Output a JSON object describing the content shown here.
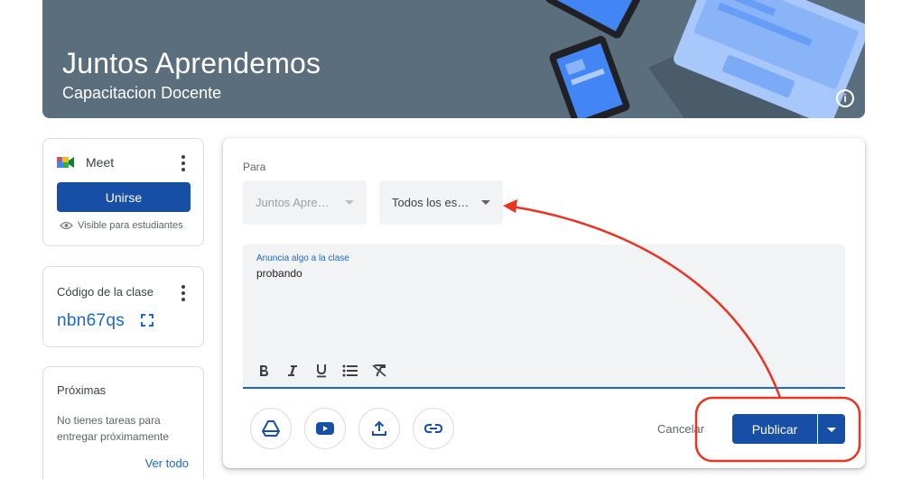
{
  "banner": {
    "title": "Juntos Aprendemos",
    "subtitle": "Capacitacion Docente",
    "info_icon": "info-icon"
  },
  "meet": {
    "label": "Meet",
    "join_label": "Unirse",
    "visible_text": "Visible para estudiantes"
  },
  "class_code": {
    "label": "Código de la clase",
    "value": "nbn67qs"
  },
  "upcoming": {
    "title": "Próximas",
    "text": "No tienes tareas para entregar próximamente",
    "see_all": "Ver todo"
  },
  "composer": {
    "for_label": "Para",
    "class_select": "Juntos Apre…",
    "students_select": "Todos los es…",
    "editor_label": "Anuncia algo a la clase",
    "editor_text": "probando",
    "format_tools": [
      "bold-icon",
      "italic-icon",
      "underline-icon",
      "bulleted-list-icon",
      "clear-format-icon"
    ],
    "attach_tools": [
      "drive-icon",
      "youtube-icon",
      "upload-icon",
      "link-icon"
    ],
    "cancel_label": "Cancelar",
    "publish_label": "Publicar"
  },
  "colors": {
    "primary": "#174ea6",
    "link": "#1967d2",
    "annotation": "#ea3323"
  }
}
